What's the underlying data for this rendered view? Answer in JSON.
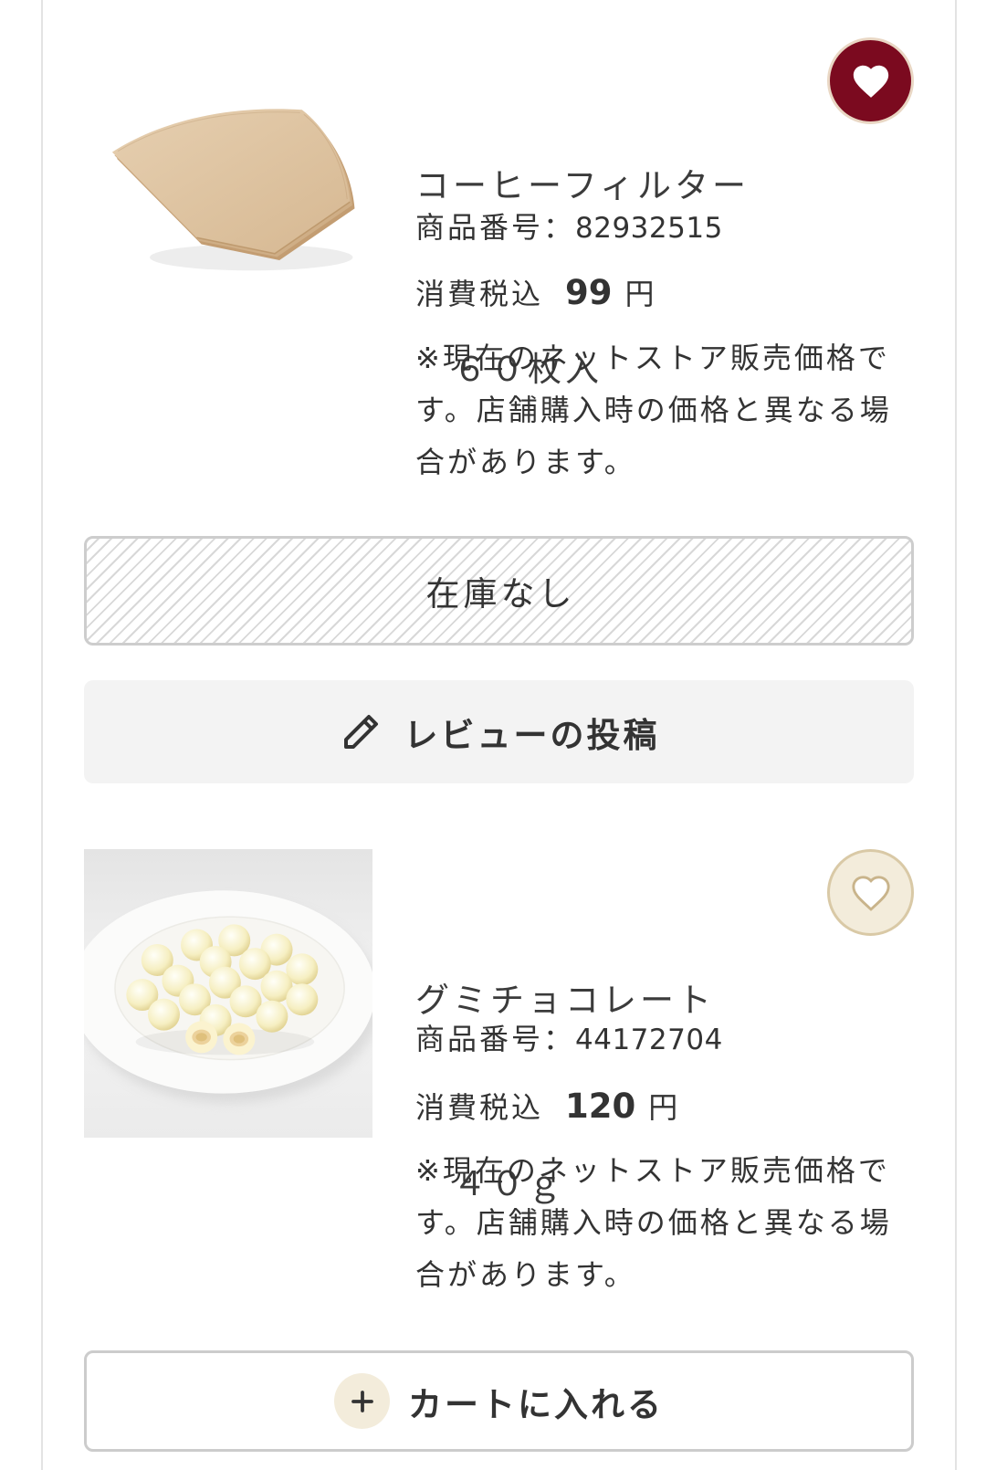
{
  "products": [
    {
      "title_lines": [
        "コーヒーフィルター",
        "　６０枚入"
      ],
      "favorited": true,
      "number_label": "商品番号：",
      "number": "82932515",
      "tax_label": "消費税込",
      "price": "99",
      "currency": "円",
      "note": "※現在のネットストア販売価格です。店舗購入時の価格と異なる場合があります。",
      "stock_status": "在庫なし",
      "review_label": "レビューの投稿"
    },
    {
      "title_lines": [
        "グミチョコレート",
        "　４０ｇ"
      ],
      "favorited": false,
      "number_label": "商品番号：",
      "number": "44172704",
      "tax_label": "消費税込",
      "price": "120",
      "currency": "円",
      "note": "※現在のネットストア販売価格です。店舗購入時の価格と異なる場合があります。",
      "cart_label": "カートに入れる"
    }
  ],
  "icons": {
    "favorite_on": "heart-filled-icon",
    "favorite_off": "heart-outline-icon",
    "review": "pencil-icon",
    "add_to_cart": "plus-icon"
  },
  "colors": {
    "accent": "#7b0a1f",
    "cream": "#f3ecdb",
    "cream_border": "#d9c9a6",
    "text": "#333333",
    "button_gray": "#f3f3f3",
    "border": "#cdcdcd"
  }
}
